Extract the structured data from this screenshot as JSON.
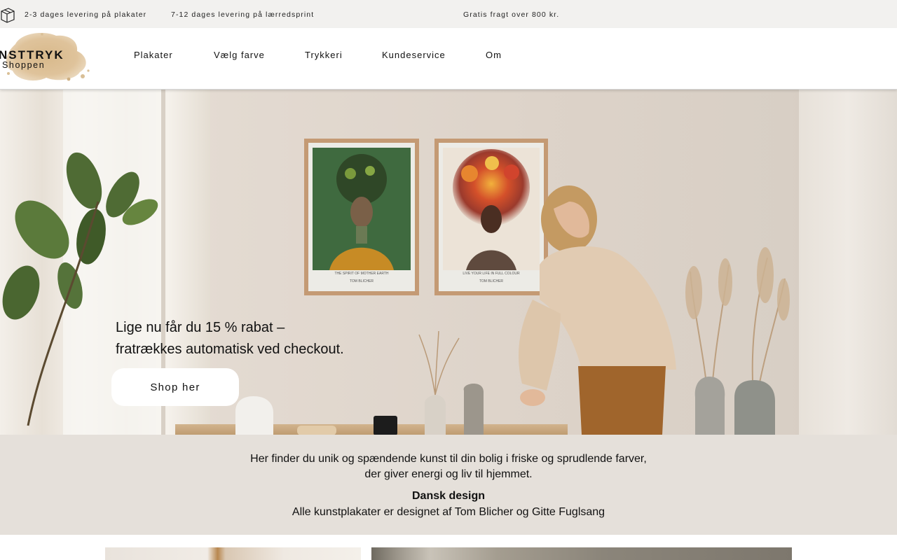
{
  "announcement": {
    "item1": "2-3 dages levering på plakater",
    "item2": "7-12 dages levering på lærredsprint",
    "item3": "Gratis fragt over 800 kr."
  },
  "logo": {
    "title": "NSTTRYK",
    "subtitle": "Shoppen"
  },
  "nav": {
    "items": [
      "Plakater",
      "Vælg farve",
      "Trykkeri",
      "Kundeservice",
      "Om"
    ]
  },
  "hero": {
    "promo_line1": "Lige nu får du 15 % rabat –",
    "promo_line2": "fratrækkes automatisk ved checkout.",
    "shop_button": "Shop her",
    "poster1_caption": "THE SPIRIT OF MOTHER EARTH",
    "poster1_artist": "TOM BLICHER",
    "poster2_caption": "LIVE YOUR LIFE IN FULL COLOUR",
    "poster2_artist": "TOM BLICHER"
  },
  "intro": {
    "line1": "Her finder du unik og spændende kunst til din bolig i friske og sprudlende farver,",
    "line2": "der giver energi og liv til hjemmet.",
    "heading": "Dansk design",
    "line3": "Alle kunstplakater er designet af Tom Blicher og Gitte Fuglsang"
  },
  "icons": {
    "announcement": "box-icon"
  },
  "colors": {
    "announcement_bg": "#f2f1ef",
    "intro_bg": "#e5e0da",
    "button_bg": "#ffffff"
  }
}
